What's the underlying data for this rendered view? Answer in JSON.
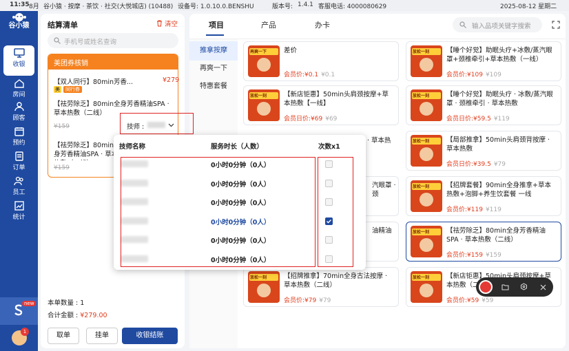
{
  "status_bar": {
    "time": "11:35",
    "date_short": "8月",
    "store": "谷小猿 · 按摩 · 茶饮 · 社交(大悦城店) (10488)",
    "device_label": "设备号: 1.0.10.0.BENSHU",
    "version_label": "版本号: ",
    "version_value": "1.4.1",
    "hotline_label": "客服电话: 4000080629",
    "datetime_right": "2025-08-12 星期二"
  },
  "left_nav": {
    "logo_text": "谷小猿",
    "items": [
      {
        "label": "收银",
        "icon": "cashier-icon"
      },
      {
        "label": "房间",
        "icon": "room-icon"
      },
      {
        "label": "顾客",
        "icon": "customer-icon"
      },
      {
        "label": "预约",
        "icon": "calendar-icon"
      },
      {
        "label": "订单",
        "icon": "order-icon"
      },
      {
        "label": "员工",
        "icon": "staff-icon"
      },
      {
        "label": "统计",
        "icon": "statistics-icon"
      }
    ],
    "new_badge": "new",
    "avatar_badge": "1"
  },
  "cart": {
    "title": "结算清单",
    "clear_label": "清空",
    "search_placeholder": "手机号或姓名查询",
    "voucher_header": "美团券核销",
    "item1": {
      "name": "【双人同行】80min芳香...",
      "price": "¥279",
      "tag1": "美",
      "tag2": "同行券"
    },
    "item2": {
      "name": "【祛劳除乏】80min全身芳香精油SPA · 草本热敷（二线）",
      "orig_price": "¥159"
    },
    "item3": {
      "name": "【祛劳除乏】80min全身芳香精油SPA · 草本热敷（二线）",
      "orig_price": "¥159"
    },
    "tech_label": "技师 :",
    "count_label": "本单数量 :",
    "count_value": "1",
    "total_label": "合计金额 :",
    "total_value": "¥279.00",
    "buttons": {
      "cancel": "取单",
      "hold": "挂单",
      "checkout": "收银结账"
    }
  },
  "main": {
    "tabs": [
      "项目",
      "产品",
      "办卡"
    ],
    "search_placeholder": "输入品项关键字搜索",
    "categories": [
      "推拿按摩",
      "再爽一下",
      "特惠套餐"
    ],
    "thumb_labels": [
      "再爽一下",
      "放松一刻",
      "放松一刻",
      "放松一刻",
      "放松一刻",
      "放松一刻",
      "放松一刻",
      "放松一刻",
      "放松一刻",
      "放松一刻",
      "放松一刻",
      "放松一刻"
    ],
    "cards": [
      {
        "name": "差价",
        "price": "会员价:¥0.1",
        "orig": "¥0.1"
      },
      {
        "name": "【睡个好觉】助眠头疗+冰敷/蒸汽眼罩+颈椎牵引+草本热敷（一线）",
        "price": "会员价:¥109",
        "orig": "¥109"
      },
      {
        "name": "【新店钜惠】50min头肩颈按摩+草本热敷【一线】",
        "price": "会员日价:¥69",
        "orig": "¥69"
      },
      {
        "name": "【睡个好觉】助眠头疗 · 冰敷/蒸汽眼罩 · 颈椎牵引 · 草本热敷",
        "price": "会员日价:¥59.5",
        "orig": "¥119"
      },
      {
        "name": "【局部推拿】50min头肩颈背按摩 · 草本热敷",
        "price": "会员日价:¥39.5",
        "orig": "¥79"
      },
      {
        "name": "【招牌套餐】90min全身推拿+草本热敷+泡脚+养生饮套餐 一线",
        "price": "会员价:¥119",
        "orig": "¥119"
      },
      {
        "name": "【祛劳除乏】80min全身芳香精油SPA · 草本热敷（二线）",
        "price": "会员价:¥159",
        "orig": "¥159"
      },
      {
        "name": "【招牌推拿】70min全身古法按摩 · 草本热敷（二线）",
        "price": "会员价:¥79",
        "orig": "¥79"
      },
      {
        "name": "【新店钜惠】50min头肩颈按摩+草本热敷（二线）",
        "price": "会员价:¥59",
        "orig": "¥59"
      }
    ],
    "hidden_card_fragments": [
      "· 草本热",
      "汽眼罩 · 颈",
      "油精油"
    ]
  },
  "dropdown": {
    "headers": {
      "name": "技师名称",
      "duration": "服务时长（人数）",
      "count": "次数x1"
    },
    "rows": [
      {
        "duration": "0小时0分钟（0人）",
        "checked": false
      },
      {
        "duration": "0小时0分钟（0人）",
        "checked": false
      },
      {
        "duration": "0小时0分钟（0人）",
        "checked": false
      },
      {
        "duration": "0小时0分钟（0人）",
        "checked": true
      },
      {
        "duration": "0小时0分钟（0人）",
        "checked": false
      },
      {
        "duration": "0小时0分钟（0人）",
        "checked": false
      }
    ]
  },
  "colors": {
    "primary": "#1f4aa0",
    "accent": "#e03c1c",
    "voucher_orange": "#f5821f"
  }
}
